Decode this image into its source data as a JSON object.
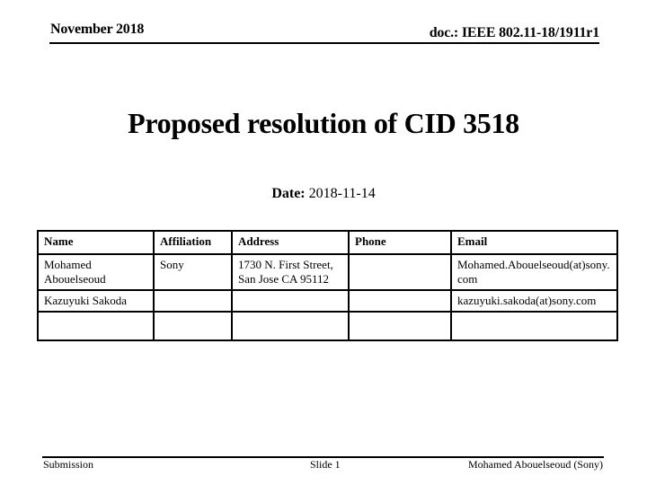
{
  "header": {
    "date": "November 2018",
    "doc_id": "doc.: IEEE 802.11-18/1911r1"
  },
  "title": "Proposed resolution of CID 3518",
  "date_line": {
    "label": "Date:",
    "value": "2018-11-14"
  },
  "authors_table": {
    "columns": [
      "Name",
      "Affiliation",
      "Address",
      "Phone",
      "Email"
    ],
    "rows": [
      {
        "name": "Mohamed Abouelseoud",
        "affiliation": "Sony",
        "address": "1730 N. First Street, San Jose CA 95112",
        "phone": "",
        "email": "Mohamed.Abouelseoud(at)sony.com"
      },
      {
        "name": "Kazuyuki Sakoda",
        "affiliation": "",
        "address": "",
        "phone": "",
        "email": "kazuyuki.sakoda(at)sony.com"
      },
      {
        "name": "",
        "affiliation": "",
        "address": "",
        "phone": "",
        "email": ""
      }
    ]
  },
  "footer": {
    "left": "Submission",
    "center": "Slide 1",
    "right": "Mohamed Abouelseoud (Sony)"
  }
}
